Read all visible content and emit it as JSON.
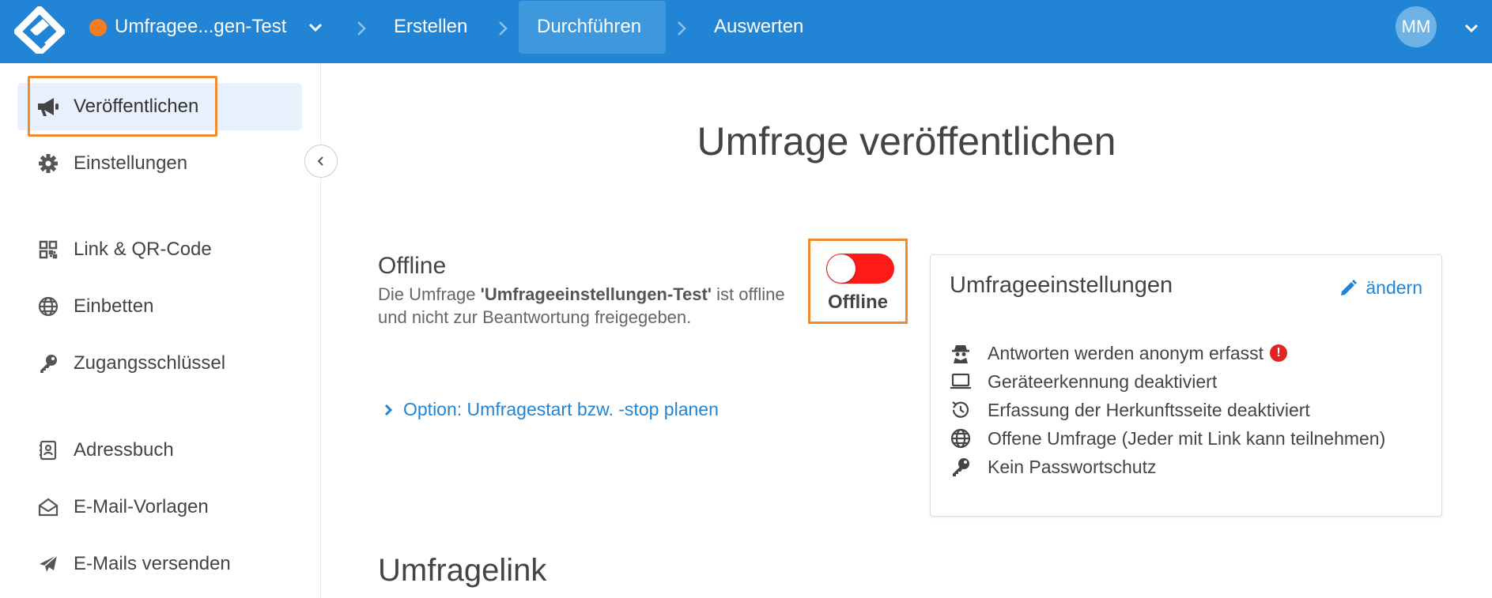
{
  "topbar": {
    "survey_name": "Umfragee...gen-Test",
    "survey_status_color": "#f57c1f",
    "breadcrumbs": [
      {
        "label": "Erstellen",
        "active": false
      },
      {
        "label": "Durchführen",
        "active": true
      },
      {
        "label": "Auswerten",
        "active": false
      }
    ],
    "user_initials": "MM",
    "accent": "#2184d4"
  },
  "sidebar": {
    "items": [
      {
        "label": "Veröffentlichen",
        "icon": "megaphone-icon",
        "active": true
      },
      {
        "label": "Einstellungen",
        "icon": "gear-icon",
        "active": false
      },
      {
        "label": "Link & QR-Code",
        "icon": "qr-code-icon",
        "active": false
      },
      {
        "label": "Einbetten",
        "icon": "globe-icon",
        "active": false
      },
      {
        "label": "Zugangsschlüssel",
        "icon": "key-icon",
        "active": false
      },
      {
        "label": "Adressbuch",
        "icon": "address-book-icon",
        "active": false
      },
      {
        "label": "E-Mail-Vorlagen",
        "icon": "envelope-open-icon",
        "active": false
      },
      {
        "label": "E-Mails versenden",
        "icon": "paper-plane-icon",
        "active": false
      }
    ]
  },
  "main": {
    "title": "Umfrage veröffentlichen",
    "status": {
      "title": "Offline",
      "desc_prefix": "Die Umfrage ",
      "desc_survey": "'Umfrageeinstellungen-Test'",
      "desc_suffix": " ist offline und nicht zur Beantwortung freigegeben.",
      "toggle_label": "Offline",
      "toggle_on": false,
      "toggle_color": "#ff1a1a"
    },
    "option_link": "Option: Umfragestart bzw. -stop planen",
    "settings_card": {
      "title": "Umfrageeinstellungen",
      "edit_label": "ändern",
      "items": [
        {
          "icon": "spy-icon",
          "text": "Antworten werden anonym erfasst",
          "warning": true
        },
        {
          "icon": "laptop-icon",
          "text": "Geräteerkennung deaktiviert",
          "warning": false
        },
        {
          "icon": "history-icon",
          "text": "Erfassung der Herkunftsseite deaktiviert",
          "warning": false
        },
        {
          "icon": "globe-icon",
          "text": "Offene Umfrage (Jeder mit Link kann teilnehmen)",
          "warning": false
        },
        {
          "icon": "key-icon",
          "text": "Kein Passwortschutz",
          "warning": false
        }
      ],
      "warning_glyph": "!"
    },
    "section_link_title": "Umfragelink"
  }
}
